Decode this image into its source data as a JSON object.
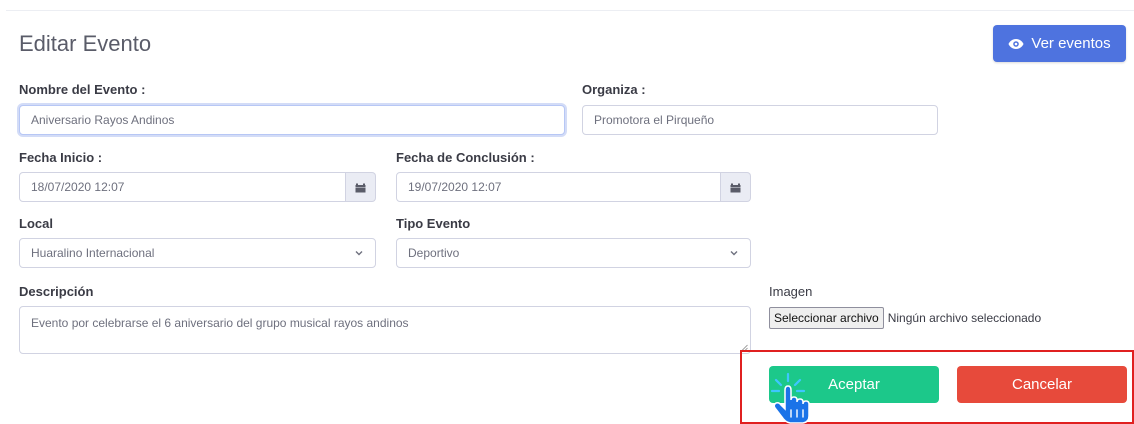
{
  "header": {
    "title": "Editar Evento",
    "view_button_label": "Ver eventos",
    "view_button_icon": "eye-icon"
  },
  "form": {
    "nombre": {
      "label": "Nombre del Evento :",
      "value": "Aniversario Rayos Andinos"
    },
    "organiza": {
      "label": "Organiza :",
      "value": "Promotora el Pirqueño"
    },
    "fecha_inicio": {
      "label": "Fecha Inicio :",
      "value": "18/07/2020 12:07",
      "icon": "calendar-icon"
    },
    "fecha_conclusion": {
      "label": "Fecha de Conclusión :",
      "value": "19/07/2020 12:07",
      "icon": "calendar-icon"
    },
    "local": {
      "label": "Local",
      "selected": "Huaralino Internacional"
    },
    "tipo_evento": {
      "label": "Tipo Evento",
      "selected": "Deportivo"
    },
    "descripcion": {
      "label": "Descripción",
      "value": "Evento por celebrarse el 6 aniversario del grupo musical rayos andinos"
    },
    "imagen": {
      "label": "Imagen",
      "button_label": "Seleccionar archivo",
      "status": "Ningún archivo seleccionado"
    }
  },
  "actions": {
    "accept_label": "Aceptar",
    "cancel_label": "Cancelar"
  },
  "colors": {
    "primary": "#4e73df",
    "success": "#1cc88a",
    "danger": "#e74a3b",
    "highlight": "#e02020",
    "cursor": "#1a73e8"
  }
}
